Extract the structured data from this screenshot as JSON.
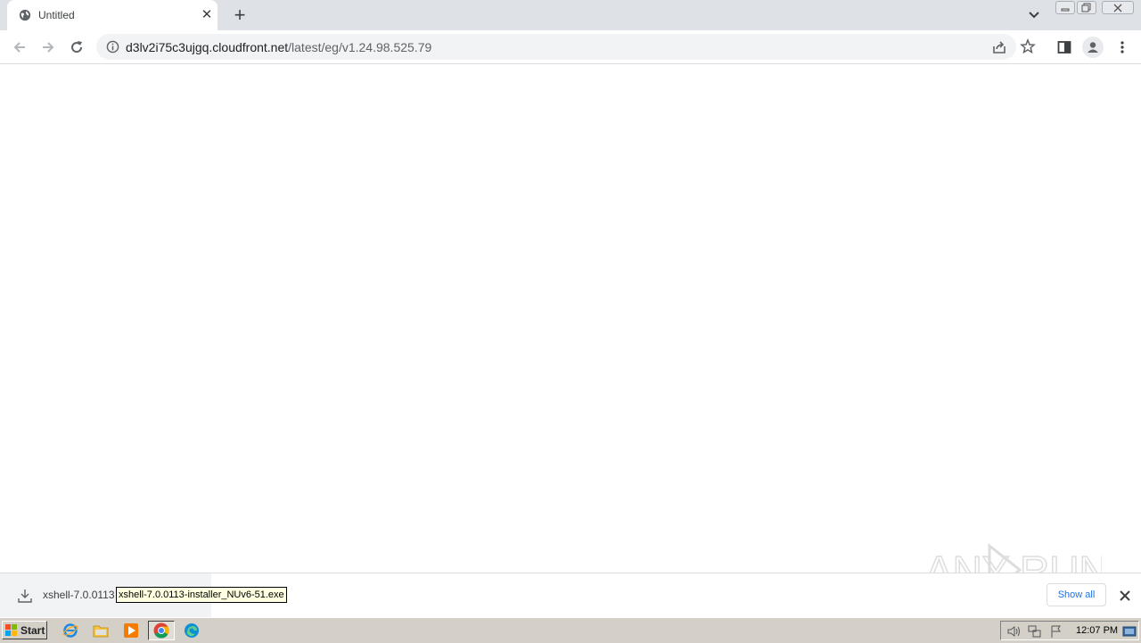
{
  "browser": {
    "tab": {
      "title": "Untitled"
    },
    "address": {
      "host": "d3lv2i75c3ujgq.cloudfront.net",
      "path": "/latest/eg/v1.24.98.525.79"
    }
  },
  "download_shelf": {
    "item_name": "xshell-7.0.0113",
    "tooltip": "xshell-7.0.0113-installer_NUv6-51.exe",
    "show_all_label": "Show all"
  },
  "watermark": {
    "text": "ANY RUN"
  },
  "taskbar": {
    "start_label": "Start",
    "clock": "12:07 PM",
    "pinned": [
      "ie-icon",
      "folder-icon",
      "media-player-icon",
      "chrome-icon",
      "edge-icon"
    ]
  },
  "colors": {
    "accent": "#1a73e8",
    "tabstrip": "#dee1e6",
    "taskbar": "#d4d0c8"
  }
}
